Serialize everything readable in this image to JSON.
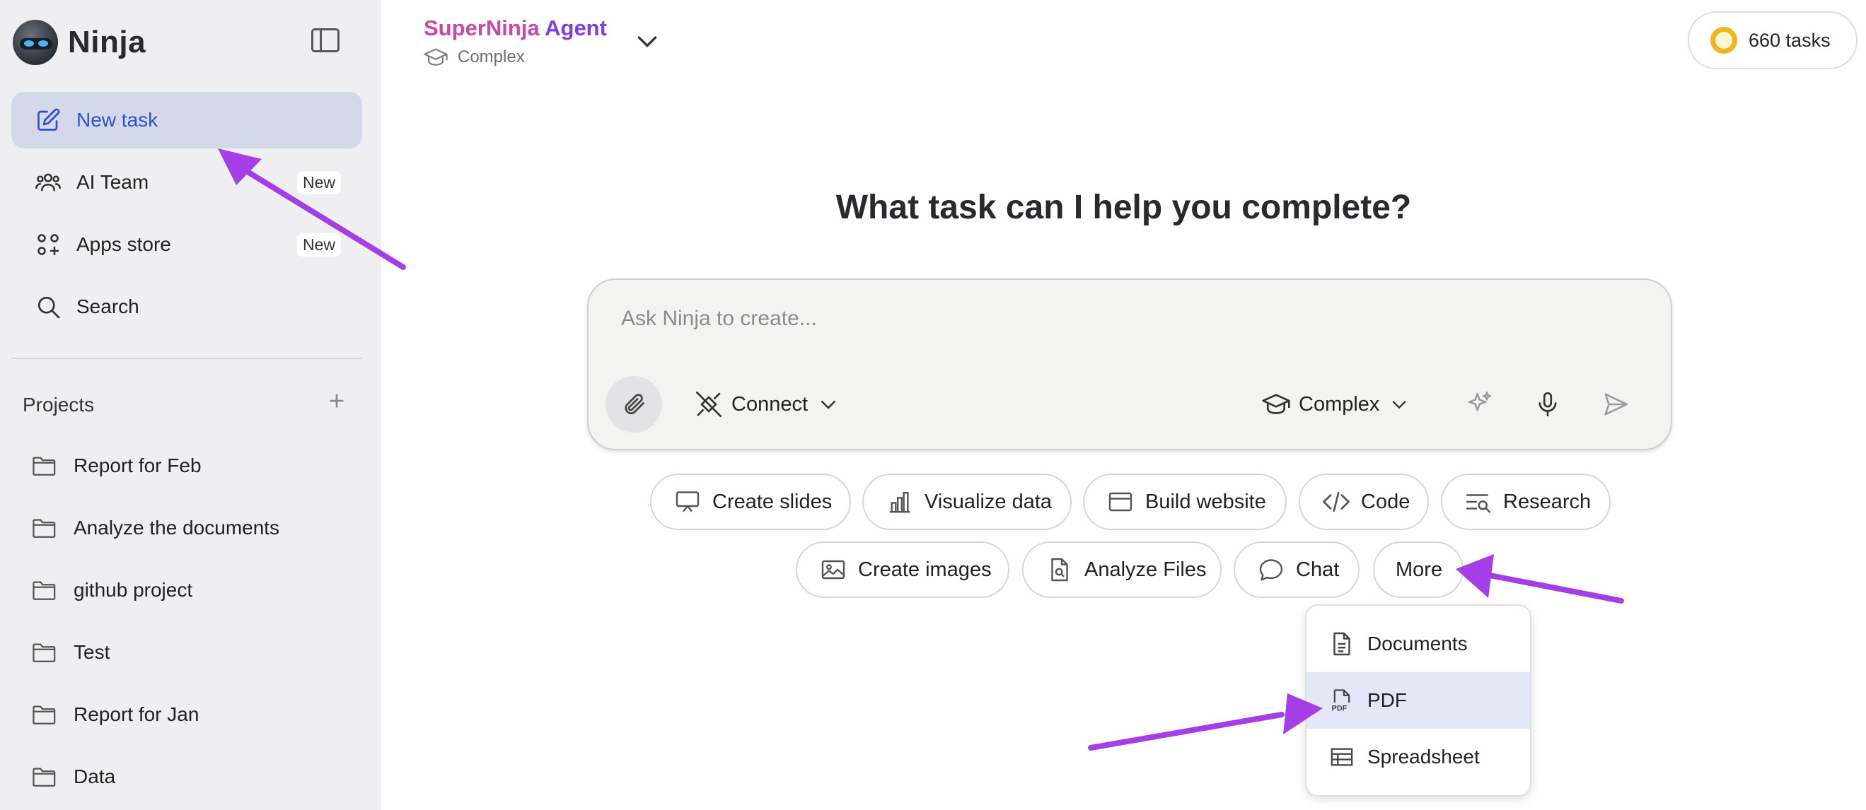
{
  "sidebar": {
    "logo_text": "Ninja",
    "nav": [
      {
        "label": "New task",
        "icon": "edit-icon",
        "active": true
      },
      {
        "label": "AI Team",
        "icon": "team-icon",
        "badge": "New"
      },
      {
        "label": "Apps store",
        "icon": "apps-icon",
        "badge": "New"
      },
      {
        "label": "Search",
        "icon": "search-icon"
      }
    ],
    "projects_title": "Projects",
    "projects": [
      "Report for Feb",
      "Analyze the documents",
      "github project",
      "Test",
      "Report for Jan",
      "Data"
    ]
  },
  "header": {
    "agent_title_part1": "SuperNinja",
    "agent_title_part2": " Agent",
    "agent_mode": "Complex",
    "tasks": "660 tasks"
  },
  "main": {
    "headline": "What task can I help you complete?",
    "composer": {
      "placeholder": "Ask Ninja to create...",
      "connect_label": "Connect",
      "mode_label": "Complex"
    },
    "quick_actions": [
      {
        "label": "Create slides",
        "icon": "presentation-icon"
      },
      {
        "label": "Visualize data",
        "icon": "bar-chart-icon"
      },
      {
        "label": "Build website",
        "icon": "browser-window-icon"
      },
      {
        "label": "Code",
        "icon": "code-icon"
      },
      {
        "label": "Research",
        "icon": "research-icon"
      },
      {
        "label": "Create images",
        "icon": "image-icon"
      },
      {
        "label": "Analyze Files",
        "icon": "file-search-icon"
      },
      {
        "label": "Chat",
        "icon": "chat-bubble-icon"
      },
      {
        "label": "More"
      }
    ],
    "more_menu": [
      {
        "label": "Documents",
        "icon": "document-icon"
      },
      {
        "label": "PDF",
        "icon": "pdf-icon",
        "highlighted": true
      },
      {
        "label": "Spreadsheet",
        "icon": "spreadsheet-icon"
      }
    ]
  },
  "colors": {
    "accent_blue": "#2e4fd8",
    "active_nav_bg": "#d4d9ea",
    "agent_pink": "#c84aa6",
    "agent_purple": "#7b3fe4",
    "annotation_arrow": "#a63ee8",
    "coin_yellow": "#f2b517"
  }
}
